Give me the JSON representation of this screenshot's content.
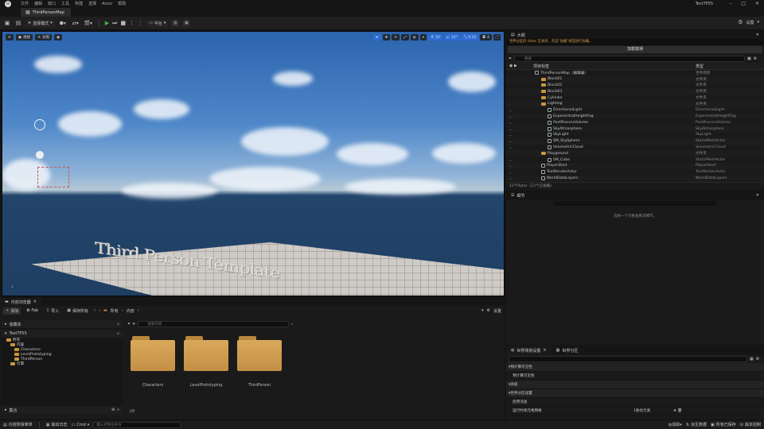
{
  "menu": [
    "文件",
    "编辑",
    "窗口",
    "工具",
    "构建",
    "选择",
    "Actor",
    "帮助"
  ],
  "project_name": "TestTP55",
  "map_tab": "ThirdPersonMap",
  "toolbar": {
    "mode_label": "选择模式",
    "platform_label": "平台",
    "settings_label": "设置"
  },
  "viewport": {
    "perspective_label": "透视",
    "lit_label": "光照",
    "snap_grid": "10",
    "snap_angle": "10°",
    "snap_scale": "0.25",
    "camera_speed": "4",
    "world_text": "Third Person Template",
    "accent": "#2f6ed8"
  },
  "outliner": {
    "tab": "大纲",
    "warning": "世界分区的 Actor 已关闭，点击“加载”按钮进行加载。",
    "load_button": "加载错误",
    "search_placeholder": "搜索",
    "col_label": "项目标签",
    "col_type": "类型",
    "rows": [
      {
        "label": "ThirdPersonMap（编辑器）",
        "type": "世界场景",
        "kind": "map",
        "indent": 0
      },
      {
        "label": "Block01",
        "type": "文件夹",
        "kind": "folder",
        "indent": 1
      },
      {
        "label": "Block02",
        "type": "文件夹",
        "kind": "folder",
        "indent": 1
      },
      {
        "label": "Block03",
        "type": "文件夹",
        "kind": "folder",
        "indent": 1
      },
      {
        "label": "Cylinder",
        "type": "文件夹",
        "kind": "folder",
        "indent": 1
      },
      {
        "label": "Lighting",
        "type": "文件夹",
        "kind": "folder",
        "indent": 1
      },
      {
        "label": "DirectionalLight",
        "type": "DirectionalLight",
        "kind": "actor",
        "indent": 2
      },
      {
        "label": "ExponentialHeightFog",
        "type": "ExponentialHeightFog",
        "kind": "actor",
        "indent": 2
      },
      {
        "label": "PostProcessVolume",
        "type": "PostProcessVolume",
        "kind": "actor",
        "indent": 2
      },
      {
        "label": "SkyAtmosphere",
        "type": "SkyAtmosphere",
        "kind": "actor",
        "indent": 2
      },
      {
        "label": "SkyLight",
        "type": "SkyLight",
        "kind": "actor",
        "indent": 2
      },
      {
        "label": "SM_SkySphere",
        "type": "StaticMeshActor",
        "kind": "actor",
        "indent": 2
      },
      {
        "label": "VolumetricCloud",
        "type": "VolumetricCloud",
        "kind": "actor",
        "indent": 2
      },
      {
        "label": "Playground",
        "type": "文件夹",
        "kind": "folder",
        "indent": 1
      },
      {
        "label": "SM_Cube",
        "type": "StaticMeshActor",
        "kind": "actor",
        "indent": 2
      },
      {
        "label": "PlayerStart",
        "type": "PlayerStart",
        "kind": "actor",
        "indent": 1
      },
      {
        "label": "TextRenderActor",
        "type": "TextRenderActor",
        "kind": "actor",
        "indent": 1
      },
      {
        "label": "WorldDataLayers",
        "type": "WorldDataLayers",
        "kind": "actor",
        "indent": 1
      }
    ],
    "footer": "12个Actor（12个已加载）"
  },
  "details": {
    "tab": "细节",
    "empty_text": "选择一个对象查看其细节。"
  },
  "world_settings": {
    "tab1": "世界场景设置",
    "tab2": "世界分区",
    "sections": [
      {
        "label": "预计算可见性"
      },
      {
        "label": "预计算可见性",
        "sub": true
      },
      {
        "label": "高级"
      },
      {
        "label": "世界分区设置"
      },
      {
        "label": "启用流送",
        "sub": true
      },
      {
        "label": "运行时单元格网格",
        "sub": true,
        "value": "1数组元素"
      }
    ]
  },
  "content_browser": {
    "tab": "内容浏览器",
    "add_label": "添加",
    "fab_label": "Fab",
    "import_label": "导入",
    "save_all_label": "保存所有",
    "path": [
      "所有",
      "内容"
    ],
    "settings_label": "设置",
    "favorites_label": "收藏夹",
    "project_label": "TestTP55",
    "tree": [
      {
        "label": "所有",
        "indent": 0
      },
      {
        "label": "内容",
        "indent": 1
      },
      {
        "label": "Characters",
        "indent": 2
      },
      {
        "label": "LevelPrototyping",
        "indent": 2
      },
      {
        "label": "ThirdPerson",
        "indent": 2
      },
      {
        "label": "引擎",
        "indent": 1
      }
    ],
    "collections_label": "集合",
    "search_placeholder": "搜索内容",
    "folders": [
      "Characters",
      "LevelPrototyping",
      "ThirdPerson"
    ],
    "item_count": "3项"
  },
  "statusbar": {
    "drawer": "内容侧滑菜单",
    "output_log": "输出日志",
    "cmd": "Cmd",
    "console_placeholder": "输入控制台命令",
    "trace": "追踪",
    "derived_data": "派生数据",
    "all_saved": "所有已保存",
    "revision_control": "版本控制"
  }
}
